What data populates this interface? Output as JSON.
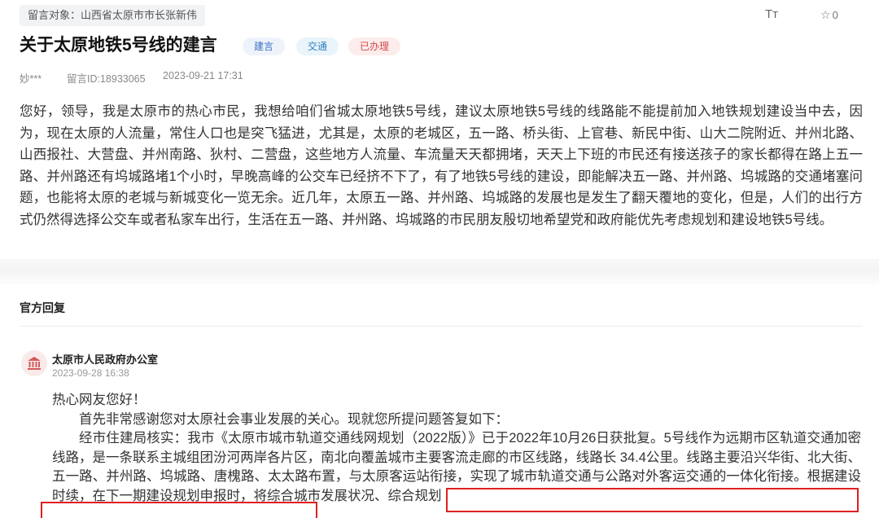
{
  "header": {
    "recipient": "留言对象：山西省太原市市长张新伟",
    "font_toggle": "Tт",
    "star_count": "0",
    "title": "关于太原地铁5号线的建言",
    "tags": [
      {
        "label": "建言",
        "color": "#3b6fc2"
      },
      {
        "label": "交通",
        "color": "#2f7fc0"
      },
      {
        "label": "已办理",
        "color": "#d24a4a"
      }
    ],
    "author": "妙***",
    "message_id": "留言ID:18933065",
    "date": "2023-09-21 17:31"
  },
  "message": {
    "body": "您好，领导，我是太原市的热心市民，我想给咱们省城太原地铁5号线，建议太原地铁5号线的线路能不能提前加入地铁规划建设当中去，因为，现在太原的人流量，常住人口也是突飞猛进，尤其是，太原的老城区，五一路、桥头街、上官巷、新民中街、山大二院附近、并州北路、山西报社、大营盘、并州南路、狄村、二营盘，这些地方人流量、车流量天天都拥堵，天天上下班的市民还有接送孩子的家长都得在路上五一路、并州路还有坞城路堵1个小时，早晚高峰的公交车已经挤不下了，有了地铁5号线的建设，即能解决五一路、并州路、坞城路的交通堵塞问题，也能将太原的老城与新城变化一览无余。近几年，太原五一路、并州路、坞城路的发展也是发生了翻天覆地的变化，但是，人们的出行方式仍然得选择公交车或者私家车出行，生活在五一路、并州路、坞城路的市民朋友殷切地希望党和政府能优先考虑规划和建设地铁5号线。"
  },
  "reply": {
    "section_title": "官方回复",
    "org_name": "太原市人民政府办公室",
    "org_time": "2023-09-28 16:38",
    "greeting": "热心网友您好！",
    "para1": "首先非常感谢您对太原社会事业发展的关心。现就您所提问题答复如下：",
    "para2": "经市住建局核实：我市《太原市城市轨道交通线网规划（2022版）》已于2022年10月26日获批复。5号线作为远期市区轨道交通加密线路，是一条联系主城组团汾河两岸各片区，南北向覆盖城市主要客流走廊的市区线路，线路长 34.4公里。线路主要沿兴华街、北大街、五一路、并州路、坞城路、唐槐路、太太路布置，与太原客运站衔接，实现了城市轨道交通与公路对外客运交通的一体化衔接。根据建设时续，在下一期建设规划申报时，将综合城市发展状况、综合规划"
  },
  "colors": {
    "highlight_box": "#e02020"
  }
}
